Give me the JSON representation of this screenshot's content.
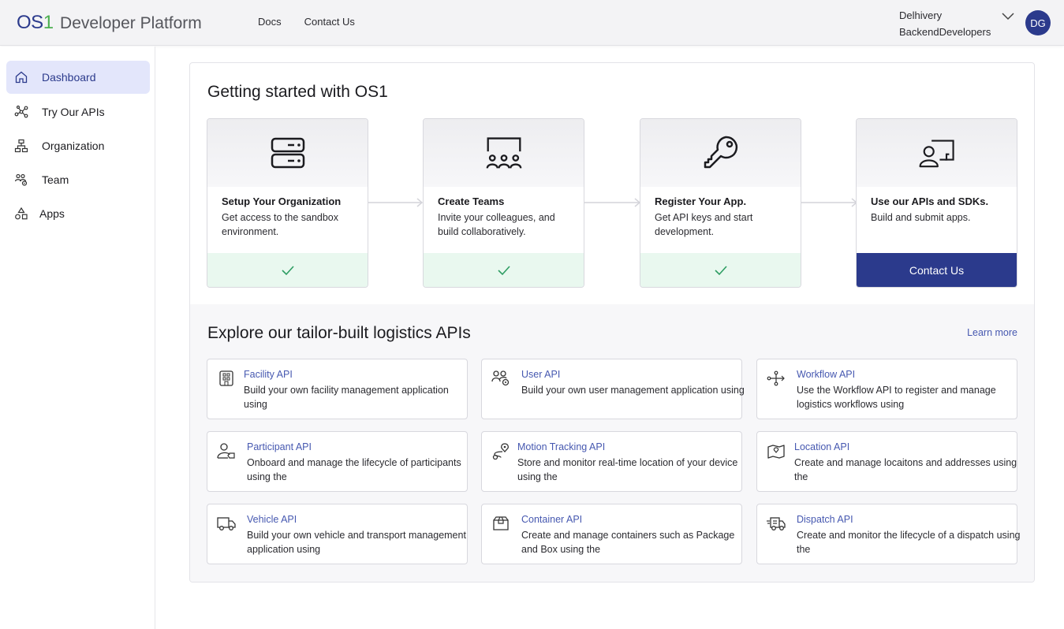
{
  "header": {
    "logo_os": "OS",
    "logo_one": "1",
    "logo_text": "Developer Platform",
    "nav": [
      "Docs",
      "Contact Us"
    ],
    "org_line1": "Delhivery",
    "org_line2": "BackendDevelopers",
    "avatar_initials": "DG"
  },
  "sidebar": {
    "items": [
      {
        "label": "Dashboard",
        "icon": "home-icon"
      },
      {
        "label": "Try Our APIs",
        "icon": "nodes-icon"
      },
      {
        "label": "Organization",
        "icon": "org-chart-icon"
      },
      {
        "label": "Team",
        "icon": "team-icon"
      },
      {
        "label": "Apps",
        "icon": "apps-icon"
      }
    ]
  },
  "getting_started": {
    "title": "Getting started with OS1",
    "steps": [
      {
        "title": "Setup Your Organization",
        "desc": "Get access to the sandbox environment.",
        "icon": "server-icon",
        "status": "done"
      },
      {
        "title": "Create Teams",
        "desc": "Invite your colleagues, and build collaboratively.",
        "icon": "team-board-icon",
        "status": "done"
      },
      {
        "title": "Register Your App.",
        "desc": "Get API keys and start development.",
        "icon": "key-icon",
        "status": "done"
      },
      {
        "title": "Use our APIs and SDKs.",
        "desc": "Build and submit apps.",
        "icon": "user-screen-icon",
        "status": "cta",
        "cta_label": "Contact Us"
      }
    ]
  },
  "explore": {
    "title": "Explore our tailor-built logistics APIs",
    "learn_more": "Learn more",
    "apis": [
      {
        "name": "Facility API",
        "desc": "Build your own facility management application using",
        "icon": "facility-icon"
      },
      {
        "name": "User API",
        "desc": "Build your own user management application using",
        "icon": "user-settings-icon"
      },
      {
        "name": "Workflow API",
        "desc": "Use the Workflow API to register and manage logistics workflows using",
        "icon": "workflow-icon"
      },
      {
        "name": "Participant API",
        "desc": "Onboard and manage the lifecycle of participants using the",
        "icon": "participant-icon"
      },
      {
        "name": "Motion Tracking API",
        "desc": "Store and monitor real-time location of your device using the",
        "icon": "motion-tracking-icon"
      },
      {
        "name": "Location API",
        "desc": "Create and manage locaitons and addresses using the",
        "icon": "map-icon"
      },
      {
        "name": "Vehicle API",
        "desc": "Build your own vehicle and transport management application using",
        "icon": "truck-icon"
      },
      {
        "name": "Container API",
        "desc": "Create and manage containers such as Package and Box using the",
        "icon": "box-icon"
      },
      {
        "name": "Dispatch API",
        "desc": "Create and monitor the lifecycle of a dispatch using the",
        "icon": "dispatch-truck-icon"
      }
    ]
  },
  "colors": {
    "brand": "#2b3a8c",
    "accent_green": "#4caf50",
    "done_bg": "#e9f8ef",
    "link": "#4658b0"
  }
}
